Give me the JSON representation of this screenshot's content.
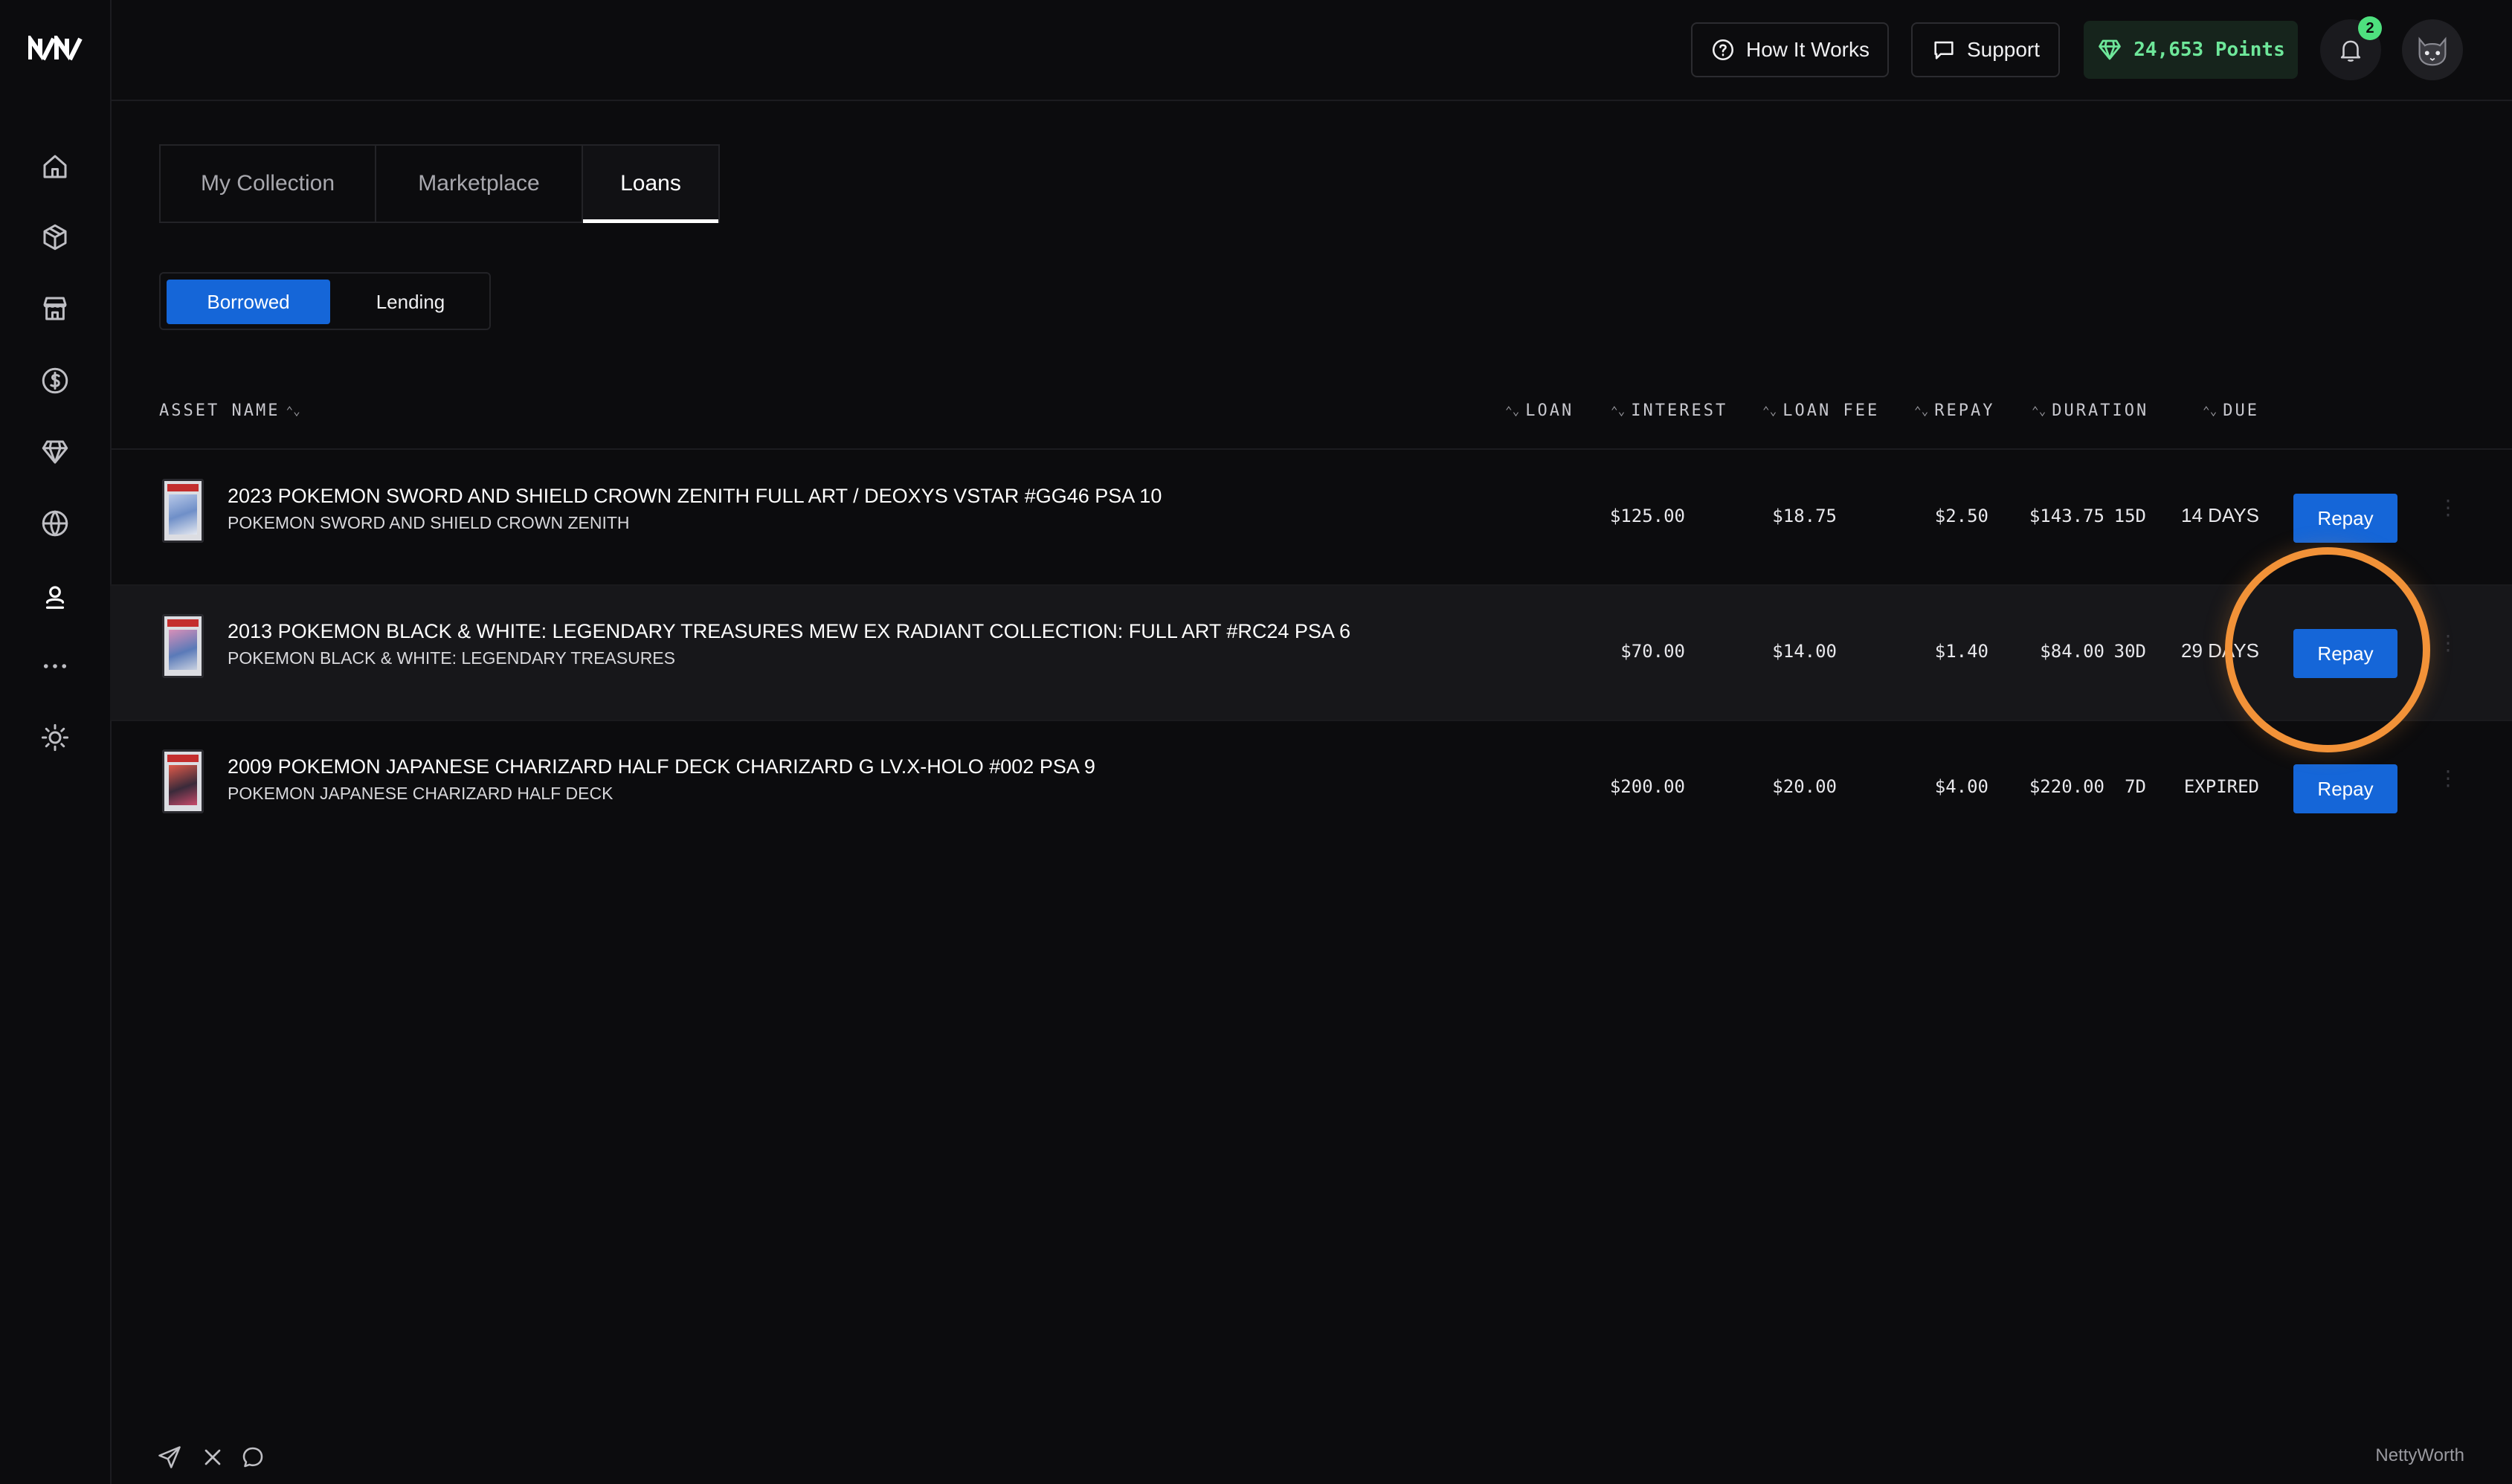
{
  "app": {
    "logo_text": "N/N",
    "brand": "NettyWorth"
  },
  "header": {
    "how_it_works": "How It Works",
    "support": "Support",
    "points": "24,653 Points",
    "notifications_count": "2"
  },
  "sidebar": {
    "items": [
      {
        "icon": "home-icon"
      },
      {
        "icon": "box-icon"
      },
      {
        "icon": "store-icon"
      },
      {
        "icon": "dollar-icon"
      },
      {
        "icon": "diamond-icon"
      },
      {
        "icon": "globe-icon"
      },
      {
        "icon": "user-icon",
        "active": true
      },
      {
        "icon": "more-icon"
      },
      {
        "icon": "sun-icon"
      }
    ]
  },
  "tabs": [
    {
      "label": "My Collection"
    },
    {
      "label": "Marketplace"
    },
    {
      "label": "Loans",
      "active": true
    }
  ],
  "segment": {
    "borrowed": "Borrowed",
    "lending": "Lending",
    "active": "Borrowed"
  },
  "table": {
    "headers": {
      "asset_name": "ASSET NAME",
      "loan": "LOAN",
      "interest": "INTEREST",
      "loan_fee": "LOAN FEE",
      "repay": "REPAY",
      "duration": "DURATION",
      "due": "DUE"
    },
    "rows": [
      {
        "title": "2023 POKEMON SWORD AND SHIELD CROWN ZENITH FULL ART / DEOXYS VSTAR #GG46 PSA 10",
        "subtitle": "POKEMON SWORD AND SHIELD CROWN ZENITH",
        "loan": "$125.00",
        "interest": "$18.75",
        "loan_fee": "$2.50",
        "repay": "$143.75",
        "duration": "15D",
        "due": "14 DAYS",
        "action": "Repay"
      },
      {
        "title": "2013 POKEMON BLACK & WHITE: LEGENDARY TREASURES MEW EX RADIANT COLLECTION: FULL ART #RC24 PSA 6",
        "subtitle": "POKEMON BLACK & WHITE: LEGENDARY TREASURES",
        "loan": "$70.00",
        "interest": "$14.00",
        "loan_fee": "$1.40",
        "repay": "$84.00",
        "duration": "30D",
        "due": "29 DAYS",
        "action": "Repay"
      },
      {
        "title": "2009 POKEMON JAPANESE CHARIZARD HALF DECK CHARIZARD G LV.X-HOLO #002 PSA 9",
        "subtitle": "POKEMON JAPANESE CHARIZARD HALF DECK",
        "loan": "$200.00",
        "interest": "$20.00",
        "loan_fee": "$4.00",
        "repay": "$220.00",
        "duration": "7D",
        "due": "EXPIRED",
        "action": "Repay"
      }
    ]
  },
  "footer": {
    "icons": [
      "send-icon",
      "x-icon",
      "chat-icon"
    ]
  },
  "colors": {
    "accent": "#1566d8",
    "points_green": "#6ee79a",
    "highlight": "#f29238",
    "background": "#0c0c0e"
  }
}
